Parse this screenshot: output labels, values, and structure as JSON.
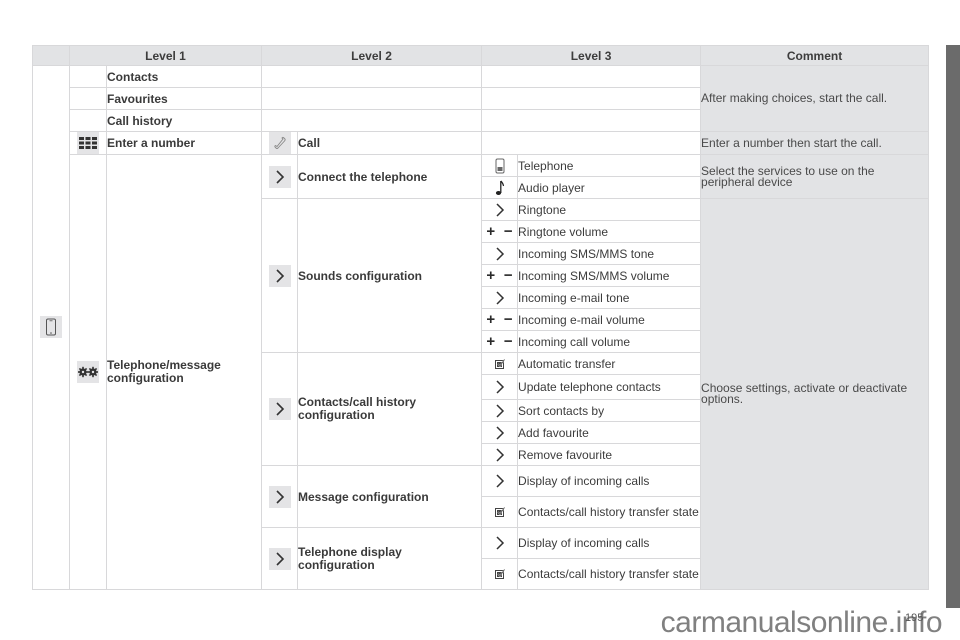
{
  "table": {
    "headers": {
      "level1": "Level 1",
      "level2": "Level 2",
      "level3": "Level 3",
      "comment": "Comment"
    },
    "root_icon": "smartphone-icon",
    "level1": {
      "contacts": "Contacts",
      "favourites": "Favourites",
      "call_history": "Call history",
      "enter_number": {
        "icon": "keypad-icon",
        "label": "Enter a number"
      },
      "telephone_config": {
        "icon": "gears-icon",
        "label": "Telephone/message configuration"
      }
    },
    "level2": {
      "call": {
        "icon": "phone-handset-icon",
        "label": "Call"
      },
      "connect": {
        "icon": "chevron-right-icon",
        "label": "Connect the telephone"
      },
      "sounds": {
        "icon": "chevron-right-icon",
        "label": "Sounds configuration"
      },
      "contacts_config": {
        "icon": "chevron-right-icon",
        "label": "Contacts/call history configuration"
      },
      "message_config": {
        "icon": "chevron-right-icon",
        "label": "Message configuration"
      },
      "display_config": {
        "icon": "chevron-right-icon",
        "label": "Telephone display configuration"
      }
    },
    "level3": {
      "telephone": {
        "icon": "phone-icon",
        "label": "Telephone"
      },
      "audio_player": {
        "icon": "music-note-icon",
        "label": "Audio player"
      },
      "ringtone": {
        "icon": "chevron-right-icon",
        "label": "Ringtone"
      },
      "ringtone_volume": {
        "icon": "plus-minus-icon",
        "label": "Ringtone volume"
      },
      "sms_tone": {
        "icon": "chevron-right-icon",
        "label": "Incoming SMS/MMS tone"
      },
      "sms_volume": {
        "icon": "plus-minus-icon",
        "label": "Incoming SMS/MMS volume"
      },
      "email_tone": {
        "icon": "chevron-right-icon",
        "label": "Incoming e-mail tone"
      },
      "email_volume": {
        "icon": "plus-minus-icon",
        "label": "Incoming e-mail volume"
      },
      "call_volume": {
        "icon": "plus-minus-icon",
        "label": "Incoming call volume"
      },
      "auto_transfer": {
        "icon": "checkbox-icon",
        "label": "Automatic transfer"
      },
      "update_contacts": {
        "icon": "chevron-right-icon",
        "label": "Update telephone contacts"
      },
      "sort_contacts": {
        "icon": "chevron-right-icon",
        "label": "Sort contacts by"
      },
      "add_favourite": {
        "icon": "chevron-right-icon",
        "label": "Add favourite"
      },
      "remove_favourite": {
        "icon": "chevron-right-icon",
        "label": "Remove favourite"
      },
      "msg_display_calls": {
        "icon": "chevron-right-icon",
        "label": "Display of incoming calls"
      },
      "msg_transfer_state": {
        "icon": "checkbox-icon",
        "label": "Contacts/call history transfer state"
      },
      "disp_display_calls": {
        "icon": "chevron-right-icon",
        "label": "Display of incoming calls"
      },
      "disp_transfer_state": {
        "icon": "checkbox-icon",
        "label": "Contacts/call history transfer state"
      }
    },
    "comments": {
      "after_choices": "After making choices, start the call.",
      "enter_number": "Enter a number then start the call.",
      "select_services": "Select the services to use on the peripheral device",
      "choose_settings": "Choose settings, activate or deactivate options."
    }
  },
  "footer": {
    "page_number": "195",
    "watermark": "carmanualsonline.info"
  },
  "colors": {
    "header_bg": "#e2e3e5",
    "border": "#d8d8da",
    "side_bar": "#6b6b6b"
  }
}
